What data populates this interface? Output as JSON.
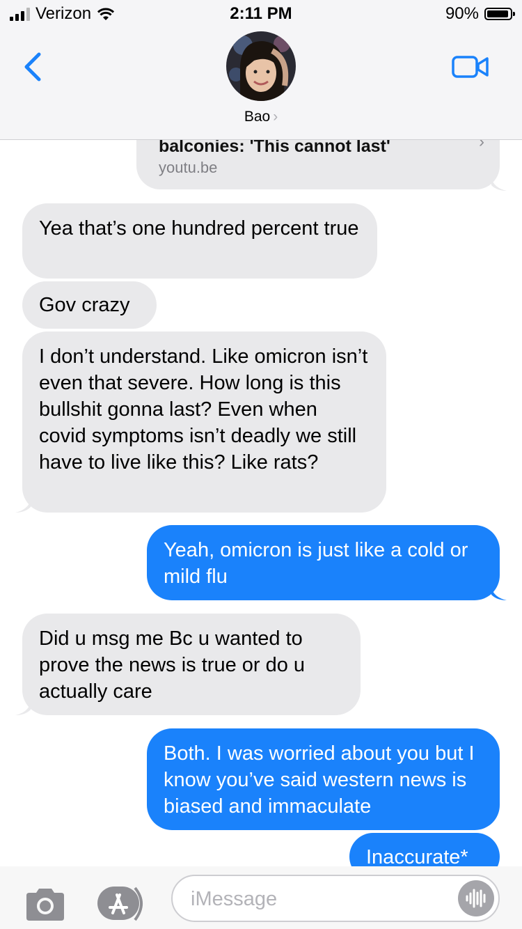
{
  "status_bar": {
    "carrier": "Verizon",
    "time": "2:11 PM",
    "battery_percent": "90%",
    "battery_level": 0.9,
    "signal_bars": 3
  },
  "header": {
    "contact_name": "Bao",
    "name_chevron": "›",
    "back_icon": "chevron-left-icon",
    "video_icon": "video-camera-icon"
  },
  "link_preview": {
    "title": "balconies: 'This cannot last'",
    "host": "youtu.be"
  },
  "messages": [
    {
      "from": "them",
      "text": "Yea that’s one hundred percent true"
    },
    {
      "from": "them",
      "text": "Gov crazy"
    },
    {
      "from": "them",
      "text": "I don’t understand. Like omicron isn’t even that severe. How long is this bullshit gonna last? Even when covid symptoms isn’t deadly we still have to live like this? Like rats?"
    },
    {
      "from": "me",
      "text": "Yeah, omicron is just like a cold or mild flu"
    },
    {
      "from": "them",
      "text": "Did u msg me Bc u wanted to prove the news is true or do u actually care"
    },
    {
      "from": "me",
      "text": "Both. I was worried about you but I know you’ve said western news is biased and immaculate"
    },
    {
      "from": "me",
      "text": "Inaccurate*"
    }
  ],
  "input_bar": {
    "placeholder": "iMessage",
    "camera_icon": "camera-icon",
    "apps_icon": "app-store-icon",
    "audio_icon": "audio-message-icon"
  },
  "colors": {
    "incoming_bubble": "#e9e9eb",
    "outgoing_bubble": "#1a82fb",
    "accent": "#1a82fb"
  }
}
